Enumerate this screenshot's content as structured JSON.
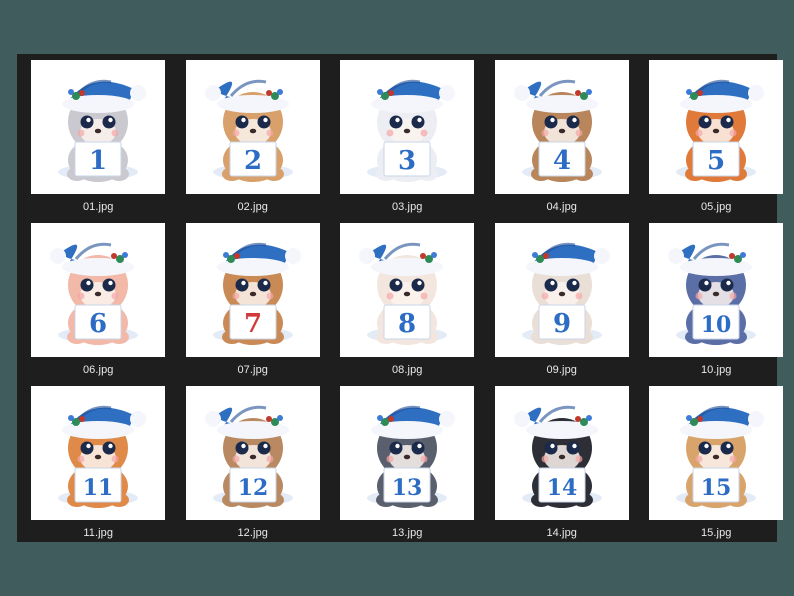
{
  "theme": {
    "hat_color": "#2f6fc2",
    "hat_dark": "#1f4f96",
    "fur_white": "#f4f6fb",
    "number_color": "#2c6cc4",
    "number_red": "#d23a3a"
  },
  "files": [
    {
      "filename": "01.jpg",
      "number": "1",
      "animal_icon": "kitten-icon",
      "fur": "#c9c9cf"
    },
    {
      "filename": "02.jpg",
      "number": "2",
      "animal_icon": "puppy-icon",
      "fur": "#d8a06a"
    },
    {
      "filename": "03.jpg",
      "number": "3",
      "animal_icon": "bunny-icon",
      "fur": "#eceef3"
    },
    {
      "filename": "04.jpg",
      "number": "4",
      "animal_icon": "bear-icon",
      "fur": "#b9855a"
    },
    {
      "filename": "05.jpg",
      "number": "5",
      "animal_icon": "fox-icon",
      "fur": "#e07a3a"
    },
    {
      "filename": "06.jpg",
      "number": "6",
      "animal_icon": "piglet-icon",
      "fur": "#f2b8a8"
    },
    {
      "filename": "07.jpg",
      "number": "7",
      "animal_icon": "reindeer-icon",
      "fur": "#c98a55"
    },
    {
      "filename": "08.jpg",
      "number": "8",
      "animal_icon": "calf-icon",
      "fur": "#f3e6df"
    },
    {
      "filename": "09.jpg",
      "number": "9",
      "animal_icon": "lamb-icon",
      "fur": "#eadfd6"
    },
    {
      "filename": "10.jpg",
      "number": "10",
      "animal_icon": "hedgehog-icon",
      "fur": "#5b6fa6"
    },
    {
      "filename": "11.jpg",
      "number": "11",
      "animal_icon": "squirrel-icon",
      "fur": "#e08a4a"
    },
    {
      "filename": "12.jpg",
      "number": "12",
      "animal_icon": "owl-icon",
      "fur": "#b98a62"
    },
    {
      "filename": "13.jpg",
      "number": "13",
      "animal_icon": "raccoon-icon",
      "fur": "#5a5f6e"
    },
    {
      "filename": "14.jpg",
      "number": "14",
      "animal_icon": "skunk-icon",
      "fur": "#2e2f36"
    },
    {
      "filename": "15.jpg",
      "number": "15",
      "animal_icon": "pony-icon",
      "fur": "#d9a46b"
    }
  ]
}
